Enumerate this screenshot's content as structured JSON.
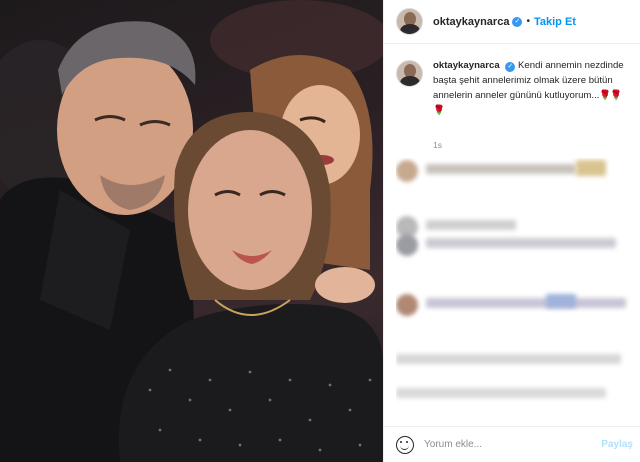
{
  "post": {
    "author": {
      "username": "oktaykaynarca",
      "verified_icon": "verified-badge-icon"
    },
    "header": {
      "separator": "•",
      "follow_label": "Takip Et"
    },
    "caption": {
      "username": "oktaykaynarca",
      "text": "Kendi annemin nezdinde başta şehit annelerimiz olmak üzere bütün annelerin anneler gününü kutluyorum...",
      "emoji": "🌹🌹🌹"
    },
    "timestamp": "1s",
    "comment_box": {
      "placeholder": "Yorum ekle...",
      "post_label": "Paylaş",
      "emoji_icon": "smiley-icon"
    },
    "colors": {
      "accent": "#0095f6",
      "verified": "#3897f0",
      "post_disabled": "#b2dffc",
      "muted": "#8e8e8e"
    }
  }
}
